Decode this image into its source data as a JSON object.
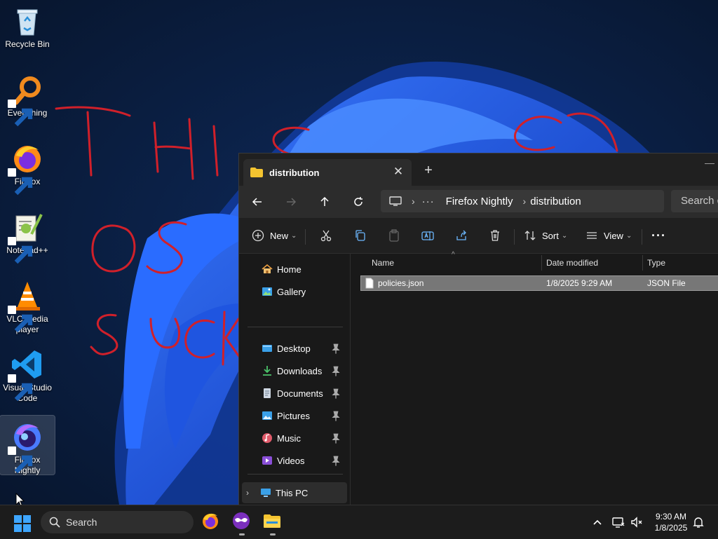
{
  "desktop": {
    "icons": [
      {
        "label": "Recycle Bin"
      },
      {
        "label": "Everything"
      },
      {
        "label": "Firefox"
      },
      {
        "label": "Notepad++"
      },
      {
        "label": "VLC media player"
      },
      {
        "label": "Visual Studio Code"
      },
      {
        "label": "Firefox Nightly"
      }
    ],
    "scribble_text": "THIS OS SUCKS"
  },
  "explorer": {
    "tab_title": "distribution",
    "breadcrumb": [
      "Firefox Nightly",
      "distribution"
    ],
    "overflow_dots": "···",
    "search_placeholder": "Search d",
    "toolbar": {
      "new_label": "New",
      "sort_label": "Sort",
      "view_label": "View",
      "more_label": "···"
    },
    "nav": {
      "home": "Home",
      "gallery": "Gallery",
      "quick_access": [
        "Desktop",
        "Downloads",
        "Documents",
        "Pictures",
        "Music",
        "Videos"
      ],
      "this_pc": "This PC"
    },
    "columns": {
      "name": "Name",
      "date": "Date modified",
      "type": "Type"
    },
    "files": [
      {
        "name": "policies.json",
        "date": "1/8/2025 9:29 AM",
        "type": "JSON File"
      }
    ]
  },
  "taskbar": {
    "search_label": "Search",
    "time": "9:30 AM",
    "date": "1/8/2025"
  },
  "colors": {
    "accent": "#0078d4",
    "folder": "#f4c430"
  }
}
